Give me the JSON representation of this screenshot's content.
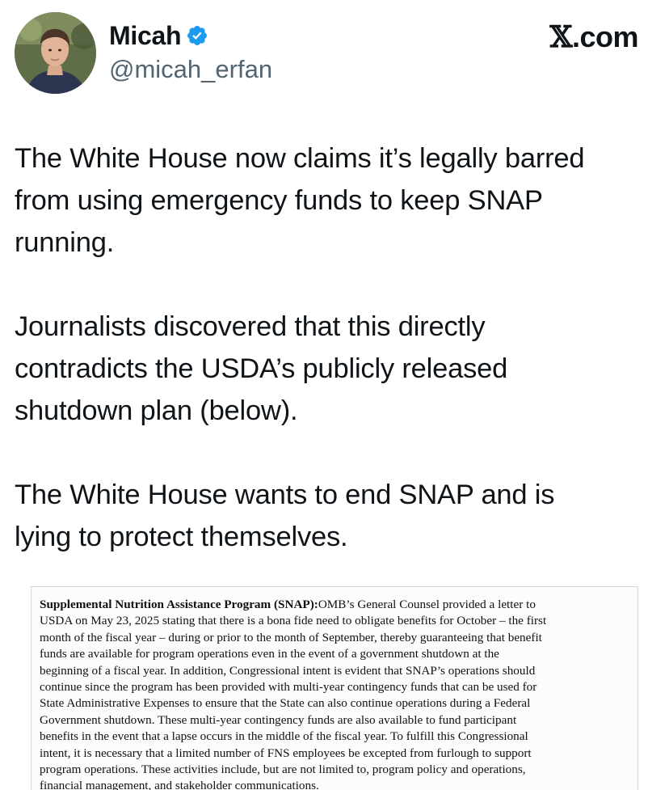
{
  "author": {
    "display_name": "Micah",
    "handle": "@micah_erfan",
    "verified_badge": "verified-checkmark-icon",
    "avatar": "profile-photo"
  },
  "brand": {
    "logo_glyph": "𝕏",
    "suffix": ".com"
  },
  "tweet": {
    "paragraphs": [
      "The White House now claims it’s legally barred from using emergency funds to keep SNAP running.",
      "Journalists discovered that this directly contradicts the USDA’s publicly released shutdown plan (below).",
      "The White House wants to end SNAP and is lying to protect themselves."
    ],
    "display_lines": [
      "The White House now claims it’s legally barred\nfrom using emergency funds to keep SNAP\nrunning.",
      "Journalists discovered that this directly\ncontradicts the USDA’s publicly released\nshutdown plan (below).",
      "The White House wants to end SNAP and is\nlying to protect themselves."
    ]
  },
  "document_excerpt": {
    "heading": "Supplemental Nutrition Assistance Program (SNAP):",
    "body": "OMB’s General Counsel provided a letter to\nUSDA on May 23, 2025 stating that there is a bona fide need to obligate benefits for October – the first\nmonth of the fiscal year – during or prior to the month of September, thereby guaranteeing that benefit\nfunds are available for program operations even in the event of a government shutdown at the\nbeginning of a fiscal year.  In addition, Congressional intent is evident that SNAP’s operations should\ncontinue since the program has been provided with multi-year contingency funds that can be used for\nState Administrative Expenses to ensure that the State can also continue operations during a Federal\nGovernment shutdown. These multi-year contingency funds are also available to fund participant\nbenefits in the event that a lapse occurs in the middle of the fiscal year. To fulfill this Congressional\nintent, it is necessary that a limited number of FNS employees be excepted from furlough to support\nprogram operations. These activities include, but are not limited to, program policy and operations,\nfinancial management, and stakeholder communications."
  },
  "colors": {
    "text_primary": "#0f1419",
    "text_secondary": "#536471",
    "verified_blue": "#1d9bf0"
  }
}
